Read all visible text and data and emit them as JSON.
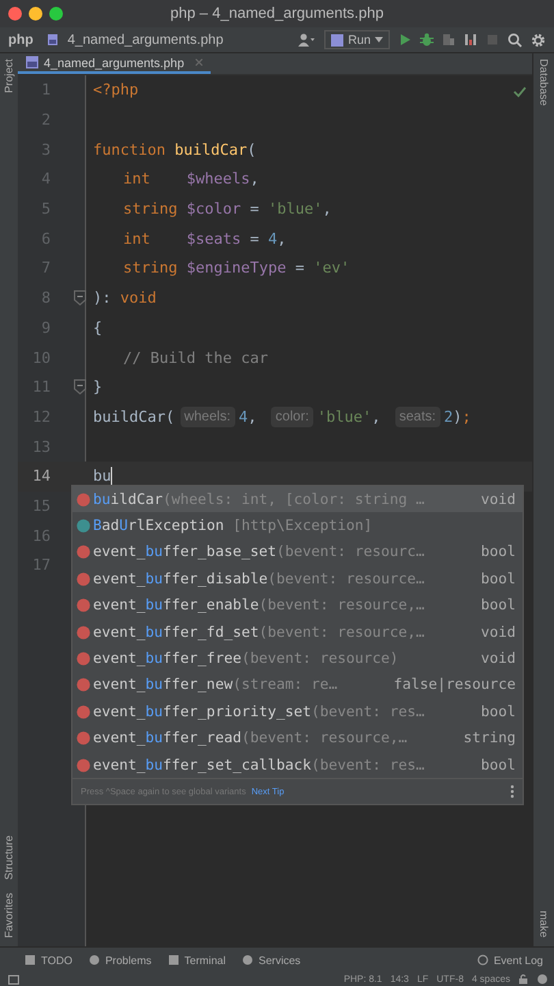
{
  "window": {
    "title": "php – 4_named_arguments.php"
  },
  "navbar": {
    "project": "php",
    "file": "4_named_arguments.php",
    "run_config": "Run"
  },
  "left_strip": {
    "top": [
      "Project"
    ],
    "bottom": [
      "Structure",
      "Favorites"
    ]
  },
  "right_strip": {
    "top": [
      "Database"
    ],
    "bottom": [
      "make"
    ]
  },
  "tabs": [
    {
      "label": "4_named_arguments.php",
      "selected": true
    }
  ],
  "editor": {
    "lines": [
      {
        "number": "1",
        "current": false,
        "fold": false,
        "indent": false,
        "tokens": [
          {
            "kind": "keyword",
            "text": "<?php"
          }
        ]
      },
      {
        "number": "2",
        "current": false,
        "fold": false,
        "indent": false
      },
      {
        "number": "3",
        "current": false,
        "fold": false,
        "indent": false,
        "tokens": [
          {
            "kind": "keyword",
            "text": "function "
          },
          {
            "kind": "fn",
            "text": "buildCar"
          },
          {
            "kind": "plain",
            "text": "("
          }
        ]
      },
      {
        "number": "4",
        "current": false,
        "fold": false,
        "indent": true,
        "tokens": [
          {
            "kind": "keyword",
            "text": "int    "
          },
          {
            "kind": "var",
            "text": "$wheels"
          },
          {
            "kind": "plain",
            "text": ","
          }
        ]
      },
      {
        "number": "5",
        "current": false,
        "fold": false,
        "indent": true,
        "tokens": [
          {
            "kind": "keyword",
            "text": "string "
          },
          {
            "kind": "var",
            "text": "$color"
          },
          {
            "kind": "plain",
            "text": " = "
          },
          {
            "kind": "string",
            "text": "'blue'"
          },
          {
            "kind": "plain",
            "text": ","
          }
        ]
      },
      {
        "number": "6",
        "current": false,
        "fold": false,
        "indent": true,
        "tokens": [
          {
            "kind": "keyword",
            "text": "int    "
          },
          {
            "kind": "var",
            "text": "$seats"
          },
          {
            "kind": "plain",
            "text": " = "
          },
          {
            "kind": "number",
            "text": "4"
          },
          {
            "kind": "plain",
            "text": ","
          }
        ]
      },
      {
        "number": "7",
        "current": false,
        "fold": false,
        "indent": true,
        "tokens": [
          {
            "kind": "keyword",
            "text": "string "
          },
          {
            "kind": "var",
            "text": "$engineType"
          },
          {
            "kind": "plain",
            "text": " = "
          },
          {
            "kind": "string",
            "text": "'ev'"
          }
        ]
      },
      {
        "number": "8",
        "current": false,
        "fold": true,
        "indent": false,
        "tokens": [
          {
            "kind": "plain",
            "text": "): "
          },
          {
            "kind": "keyword",
            "text": "void"
          }
        ]
      },
      {
        "number": "9",
        "current": false,
        "fold": false,
        "indent": false,
        "tokens": [
          {
            "kind": "plain",
            "text": "{"
          }
        ]
      },
      {
        "number": "10",
        "current": false,
        "fold": false,
        "indent": true,
        "tokens": [
          {
            "kind": "comment",
            "text": "// Build the car"
          }
        ]
      },
      {
        "number": "11",
        "current": false,
        "fold": true,
        "indent": false,
        "tokens": [
          {
            "kind": "plain",
            "text": "}"
          }
        ]
      },
      {
        "number": "12",
        "current": false,
        "fold": false,
        "indent": false,
        "tokens": [
          {
            "kind": "plain",
            "text": "buildCar("
          },
          {
            "kind": "hint",
            "text": "wheels:"
          },
          {
            "kind": "number",
            "text": "4"
          },
          {
            "kind": "plain",
            "text": ", "
          },
          {
            "kind": "hint",
            "text": "color:"
          },
          {
            "kind": "string",
            "text": "'blue'"
          },
          {
            "kind": "plain",
            "text": ", "
          },
          {
            "kind": "hint",
            "text": "seats:"
          },
          {
            "kind": "number",
            "text": "2"
          },
          {
            "kind": "plain",
            "text": ")"
          },
          {
            "kind": "keyword",
            "text": ";"
          }
        ]
      },
      {
        "number": "13",
        "current": false,
        "fold": false,
        "indent": false
      },
      {
        "number": "14",
        "current": true,
        "fold": false,
        "indent": false,
        "tokens": [
          {
            "kind": "plain",
            "text": "bu"
          }
        ]
      },
      {
        "number": "15",
        "current": false,
        "fold": false,
        "indent": false
      },
      {
        "number": "16",
        "current": false,
        "fold": false,
        "indent": false
      },
      {
        "number": "17",
        "current": false,
        "fold": false,
        "indent": false
      }
    ]
  },
  "completion": {
    "items": [
      {
        "kind": "function",
        "selected": true,
        "name": [
          {
            "text": "bu",
            "match": true
          },
          {
            "text": "ildCar",
            "match": false
          }
        ],
        "params": "(wheels: int, [color: string …",
        "type": "void"
      },
      {
        "kind": "class",
        "selected": false,
        "name": [
          {
            "text": "B",
            "match": true
          },
          {
            "text": "ad",
            "match": false
          },
          {
            "text": "U",
            "match": true
          },
          {
            "text": "rlException",
            "match": false
          }
        ],
        "params": " [http\\Exception]"
      },
      {
        "kind": "function",
        "selected": false,
        "name": [
          {
            "text": "event_",
            "match": false
          },
          {
            "text": "bu",
            "match": true
          },
          {
            "text": "ffer_base_set",
            "match": false
          }
        ],
        "params": "(bevent: resourc…",
        "type": "bool"
      },
      {
        "kind": "function",
        "selected": false,
        "name": [
          {
            "text": "event_",
            "match": false
          },
          {
            "text": "bu",
            "match": true
          },
          {
            "text": "ffer_disable",
            "match": false
          }
        ],
        "params": "(bevent: resource…",
        "type": "bool"
      },
      {
        "kind": "function",
        "selected": false,
        "name": [
          {
            "text": "event_",
            "match": false
          },
          {
            "text": "bu",
            "match": true
          },
          {
            "text": "ffer_enable",
            "match": false
          }
        ],
        "params": "(bevent: resource,…",
        "type": "bool"
      },
      {
        "kind": "function",
        "selected": false,
        "name": [
          {
            "text": "event_",
            "match": false
          },
          {
            "text": "bu",
            "match": true
          },
          {
            "text": "ffer_fd_set",
            "match": false
          }
        ],
        "params": "(bevent: resource,…",
        "type": "void"
      },
      {
        "kind": "function",
        "selected": false,
        "name": [
          {
            "text": "event_",
            "match": false
          },
          {
            "text": "bu",
            "match": true
          },
          {
            "text": "ffer_free",
            "match": false
          }
        ],
        "params": "(bevent: resource)",
        "type": "void"
      },
      {
        "kind": "function",
        "selected": false,
        "name": [
          {
            "text": "event_",
            "match": false
          },
          {
            "text": "bu",
            "match": true
          },
          {
            "text": "ffer_new",
            "match": false
          }
        ],
        "params": "(stream: re…",
        "type": "false|resource"
      },
      {
        "kind": "function",
        "selected": false,
        "name": [
          {
            "text": "event_",
            "match": false
          },
          {
            "text": "bu",
            "match": true
          },
          {
            "text": "ffer_priority_set",
            "match": false
          }
        ],
        "params": "(bevent: res…",
        "type": "bool"
      },
      {
        "kind": "function",
        "selected": false,
        "name": [
          {
            "text": "event_",
            "match": false
          },
          {
            "text": "bu",
            "match": true
          },
          {
            "text": "ffer_read",
            "match": false
          }
        ],
        "params": "(bevent: resource,…",
        "type": "string"
      },
      {
        "kind": "function",
        "selected": false,
        "name": [
          {
            "text": "event_",
            "match": false
          },
          {
            "text": "bu",
            "match": true
          },
          {
            "text": "ffer_set_callback",
            "match": false
          }
        ],
        "params": "(bevent: res…",
        "type": "bool"
      }
    ],
    "footer": {
      "hint": "Press ^Space again to see global variants",
      "link": "Next Tip"
    }
  },
  "bottom_tools": [
    "TODO",
    "Problems",
    "Terminal",
    "Services"
  ],
  "event_log": "Event Log",
  "status_bar": [
    "PHP: 8.1",
    "14:3",
    "LF",
    "UTF-8",
    "4 spaces"
  ]
}
